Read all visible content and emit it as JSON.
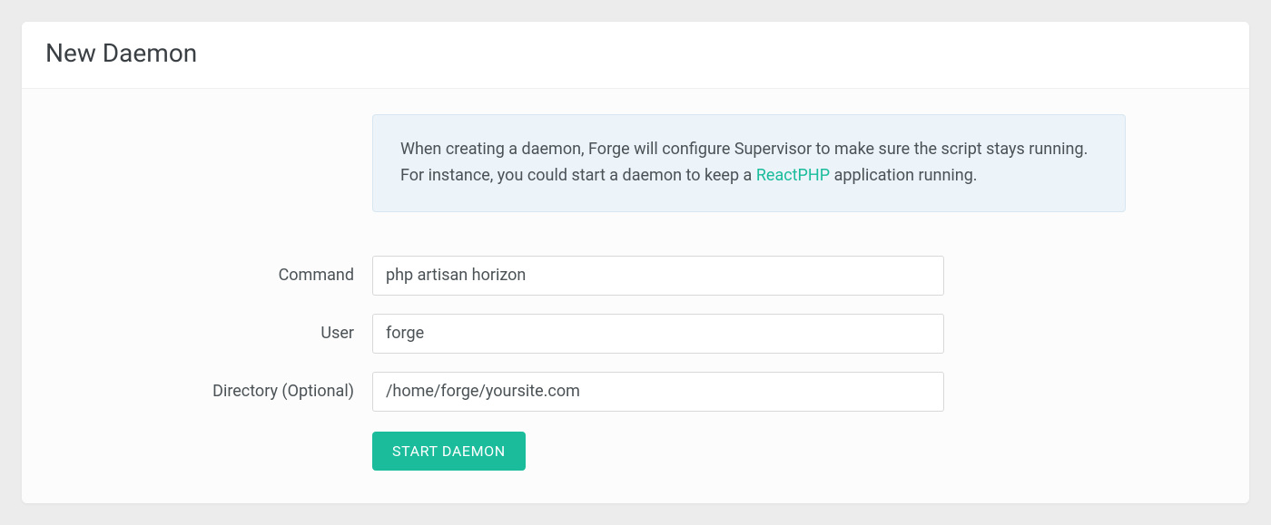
{
  "header": {
    "title": "New Daemon"
  },
  "info": {
    "text_before_link": "When creating a daemon, Forge will configure Supervisor to make sure the script stays running. For instance, you could start a daemon to keep a ",
    "link_text": "ReactPHP",
    "text_after_link": " application running."
  },
  "form": {
    "command": {
      "label": "Command",
      "value": "php artisan horizon"
    },
    "user": {
      "label": "User",
      "value": "forge"
    },
    "directory": {
      "label": "Directory (Optional)",
      "value": "/home/forge/yoursite.com"
    },
    "submit_label": "START DAEMON"
  }
}
